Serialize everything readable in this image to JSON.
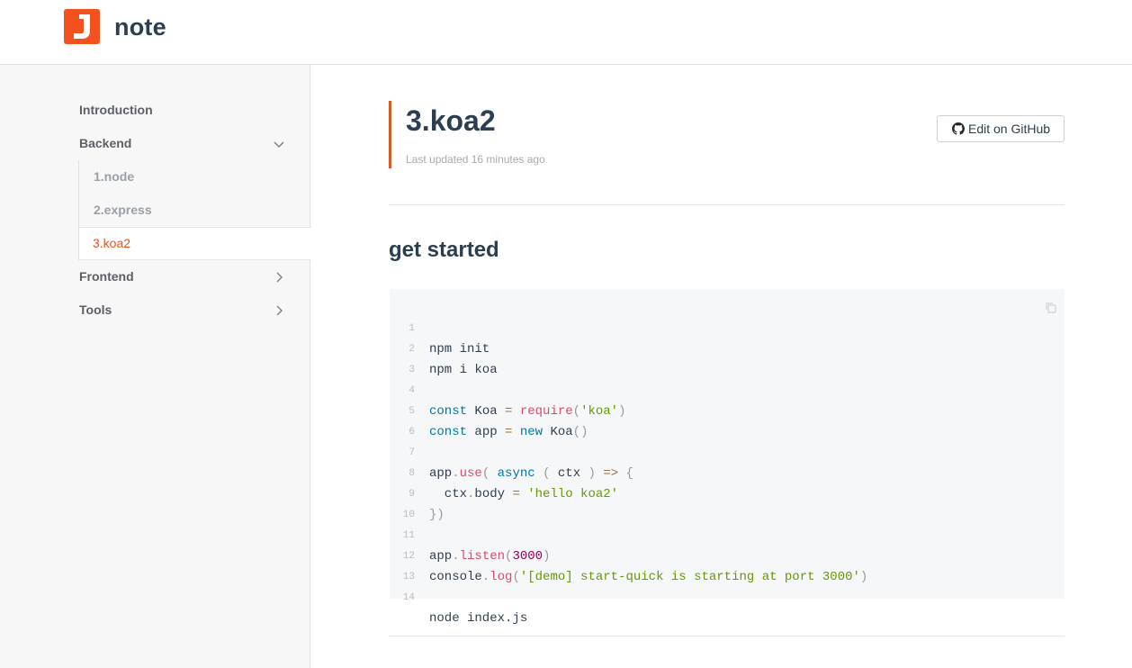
{
  "navbar": {
    "logo_letter": "J",
    "title": "note"
  },
  "sidebar": {
    "items": [
      {
        "label": "Introduction"
      },
      {
        "label": "Backend"
      },
      {
        "label": "Frontend"
      },
      {
        "label": "Tools"
      }
    ],
    "backend_children": [
      {
        "label": "1.node"
      },
      {
        "label": "2.express"
      },
      {
        "label": "3.koa2"
      }
    ],
    "active": "3.koa2"
  },
  "page": {
    "title": "3.koa2",
    "last_updated": "Last updated 16 minutes ago",
    "edit_label": "Edit on GitHub",
    "section_title": "get started"
  },
  "code": {
    "line_numbers": [
      "1",
      "2",
      "3",
      "4",
      "5",
      "6",
      "7",
      "8",
      "9",
      "10",
      "11",
      "12",
      "13",
      "14"
    ],
    "lines": [
      "npm init",
      "npm i koa",
      "",
      "const Koa = require('koa')",
      "const app = new Koa()",
      "",
      "app.use( async ( ctx ) => {",
      "  ctx.body = 'hello koa2'",
      "})",
      "",
      "app.listen(3000)",
      "console.log('[demo] start-quick is starting at port 3000')",
      "",
      "node index.js"
    ]
  },
  "colors": {
    "accent": "#e8541e",
    "logo": "#f4511e",
    "title_border": "#d75b26",
    "sidebar_bg": "#f7f7f7",
    "code_bg": "#f6f7f8"
  },
  "icons": {
    "logo": "logo-icon",
    "github": "github-icon",
    "copy": "copy-icon",
    "expand": "chevron-down-icon",
    "collapse": "chevron-right-icon"
  }
}
